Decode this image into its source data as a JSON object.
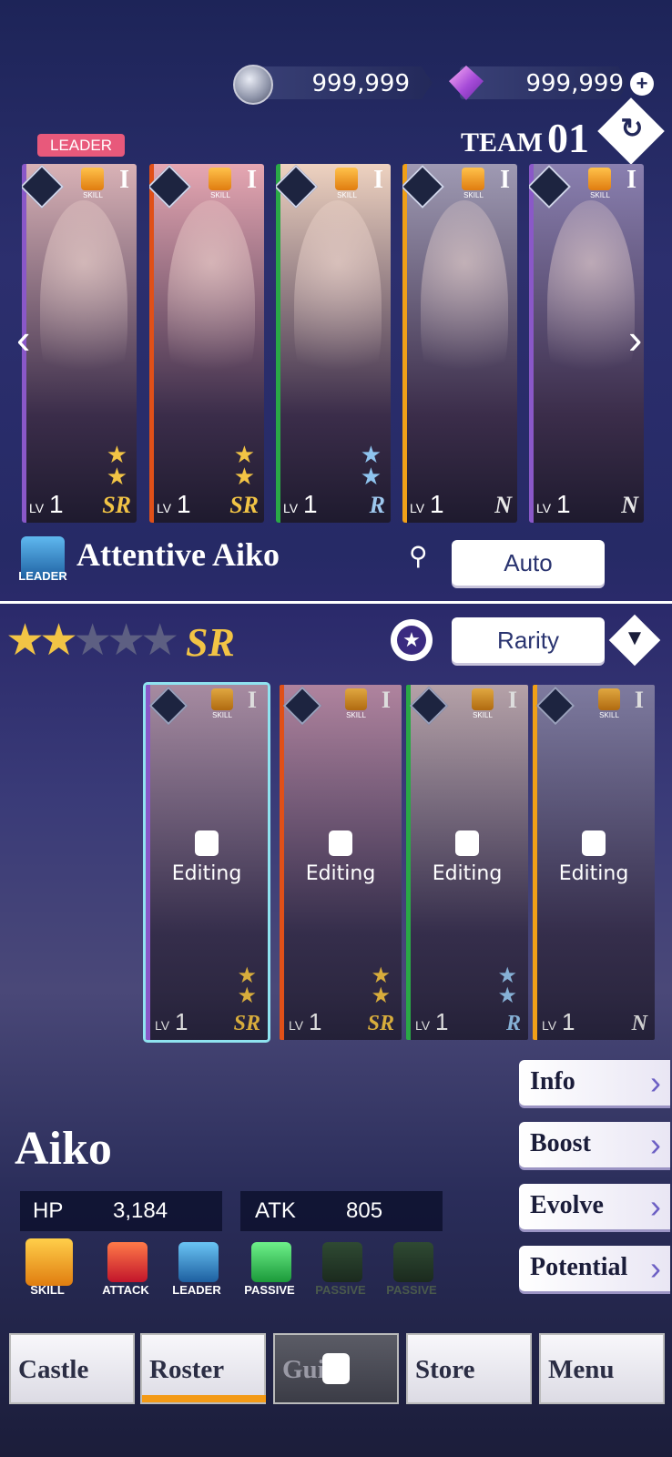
{
  "currency": {
    "coins": "999,999",
    "gems": "999,999",
    "coin_icon": "silver-coin-icon",
    "gem_icon": "purple-gem-icon",
    "add_icon": "plus-icon"
  },
  "team": {
    "leader_badge": "LEADER",
    "label": "TEAM",
    "number": "01",
    "refresh_icon": "↻"
  },
  "team_cards": [
    {
      "tier": "I",
      "lv": "LV",
      "level": "1",
      "rarity": "SR",
      "color": "#8a58c8",
      "skill": "SKILL"
    },
    {
      "tier": "I",
      "lv": "LV",
      "level": "1",
      "rarity": "SR",
      "color": "#e05018",
      "skill": "SKILL"
    },
    {
      "tier": "I",
      "lv": "LV",
      "level": "1",
      "rarity": "R",
      "color": "#2aa846",
      "skill": "SKILL"
    },
    {
      "tier": "I",
      "lv": "LV",
      "level": "1",
      "rarity": "N",
      "color": "#f0a018",
      "skill": "SKILL"
    },
    {
      "tier": "I",
      "lv": "LV",
      "level": "1",
      "rarity": "N",
      "color": "#8a58c8",
      "skill": "SKILL"
    }
  ],
  "leader_row": {
    "leader_label": "LEADER",
    "name": "Attentive Aiko",
    "auto_label": "Auto"
  },
  "filter": {
    "stars": "★★★★★",
    "rarity": "SR",
    "sort_label": "Rarity",
    "star_icon": "★",
    "sort_icon": "▼"
  },
  "roster_cards": [
    {
      "status": "Editing",
      "lv": "LV",
      "level": "1",
      "rarity": "SR",
      "tier": "I",
      "skill": "SKILL",
      "color": "#8a58c8"
    },
    {
      "status": "Editing",
      "lv": "LV",
      "level": "1",
      "rarity": "SR",
      "tier": "I",
      "skill": "SKILL",
      "color": "#e05018"
    },
    {
      "status": "Editing",
      "lv": "LV",
      "level": "1",
      "rarity": "R",
      "tier": "I",
      "skill": "SKILL",
      "color": "#2aa846"
    },
    {
      "status": "Editing",
      "lv": "LV",
      "level": "1",
      "rarity": "N",
      "tier": "I",
      "skill": "SKILL",
      "color": "#f0a018"
    }
  ],
  "side_menu": [
    {
      "label": "Info"
    },
    {
      "label": "Boost"
    },
    {
      "label": "Evolve"
    },
    {
      "label": "Potential"
    }
  ],
  "hero": {
    "name": "Aiko",
    "hp_label": "HP",
    "hp": "3,184",
    "atk_label": "ATK",
    "atk": "805"
  },
  "skills": [
    {
      "label": "SKILL"
    },
    {
      "label": "ATTACK"
    },
    {
      "label": "LEADER"
    },
    {
      "label": "PASSIVE"
    },
    {
      "label": "PASSIVE"
    },
    {
      "label": "PASSIVE"
    }
  ],
  "nav": [
    {
      "label": "Castle"
    },
    {
      "label": "Roster"
    },
    {
      "label": "Guild"
    },
    {
      "label": "Store"
    },
    {
      "label": "Menu"
    }
  ]
}
